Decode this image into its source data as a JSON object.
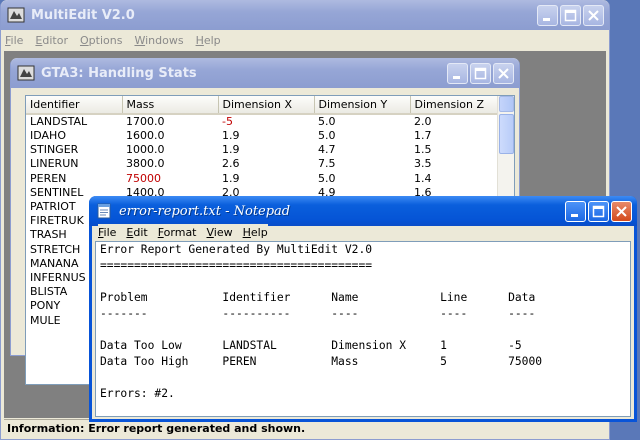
{
  "main_window": {
    "title": "MultiEdit V2.0",
    "menu": [
      "File",
      "Editor",
      "Options",
      "Windows",
      "Help"
    ]
  },
  "gta_window": {
    "title": "GTA3: Handling Stats",
    "columns": [
      "Identifier",
      "Mass",
      "Dimension X",
      "Dimension Y",
      "Dimension Z"
    ],
    "rows": [
      [
        "LANDSTAL",
        "1700.0",
        "-5",
        "5.0",
        "2.0"
      ],
      [
        "IDAHO",
        "1600.0",
        "1.9",
        "5.0",
        "1.7"
      ],
      [
        "STINGER",
        "1000.0",
        "1.9",
        "4.7",
        "1.5"
      ],
      [
        "LINERUN",
        "3800.0",
        "2.6",
        "7.5",
        "3.5"
      ],
      [
        "PEREN",
        "75000",
        "1.9",
        "5.0",
        "1.4"
      ],
      [
        "SENTINEL",
        "1400.0",
        "2.0",
        "4.9",
        "1.6"
      ],
      [
        "PATRIOT",
        "",
        "",
        "",
        ""
      ],
      [
        "FIRETRUK",
        "",
        "",
        "",
        ""
      ],
      [
        "TRASH",
        "",
        "",
        "",
        ""
      ],
      [
        "STRETCH",
        "",
        "",
        "",
        ""
      ],
      [
        "MANANA",
        "",
        "",
        "",
        ""
      ],
      [
        "INFERNUS",
        "",
        "",
        "",
        ""
      ],
      [
        "BLISTA",
        "",
        "",
        "",
        ""
      ],
      [
        "PONY",
        "",
        "",
        "",
        ""
      ],
      [
        "MULE",
        "",
        "",
        "",
        ""
      ]
    ],
    "error_cells": [
      [
        0,
        2
      ],
      [
        4,
        1
      ]
    ],
    "error_color": "#c00000"
  },
  "notepad": {
    "title": "error-report.txt - Notepad",
    "menu": [
      "File",
      "Edit",
      "Format",
      "View",
      "Help"
    ],
    "lines": [
      "Error Report Generated By MultiEdit V2.0",
      "========================================",
      "",
      "Problem           Identifier      Name            Line      Data",
      "-------           ----------      ----            ----      ----",
      "",
      "Data Too Low      LANDSTAL        Dimension X     1         -5",
      "Data Too High     PEREN           Mass            5         75000",
      "",
      "Errors: #2."
    ]
  },
  "status_bar": {
    "text": "Information: Error report generated and shown."
  },
  "colors": {
    "active_title": "#0a5fdc",
    "inactive_title": "#96a6d6",
    "desktop": "#5a78b8"
  }
}
